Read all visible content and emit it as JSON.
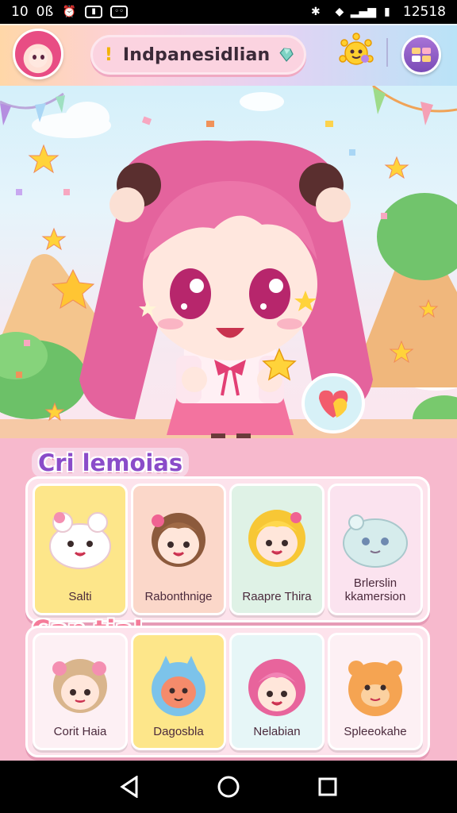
{
  "status_bar": {
    "time": "10",
    "left_texts": [
      "0ß"
    ],
    "clock": "12518"
  },
  "header": {
    "title": "Indpanesidlian"
  },
  "sections": [
    {
      "title": "Cri lemoias",
      "cards": [
        {
          "label": "Salti",
          "theme": "yellow"
        },
        {
          "label": "Rabonthnige",
          "theme": "peach"
        },
        {
          "label": "Raapre Thira",
          "theme": "mint"
        },
        {
          "label": "Brlerslin\nkkamersion",
          "theme": "lilac"
        }
      ]
    },
    {
      "title": "Can tia!",
      "cards": [
        {
          "label": "Corit Haia",
          "theme": "cream"
        },
        {
          "label": "Dagosbla",
          "theme": "yellow"
        },
        {
          "label": "Nelabian",
          "theme": "sky"
        },
        {
          "label": "Spleeokahe",
          "theme": "cream"
        }
      ]
    }
  ],
  "colors": {
    "accent": "#8a4cc9",
    "pink": "#f7b9cd",
    "hair": "#e86aa6"
  },
  "icons": {
    "title": "exclamation-icon",
    "gem": "gem-icon",
    "sun": "sun-icon",
    "menu": "menu-grid-icon",
    "heart": "heart-icon"
  }
}
